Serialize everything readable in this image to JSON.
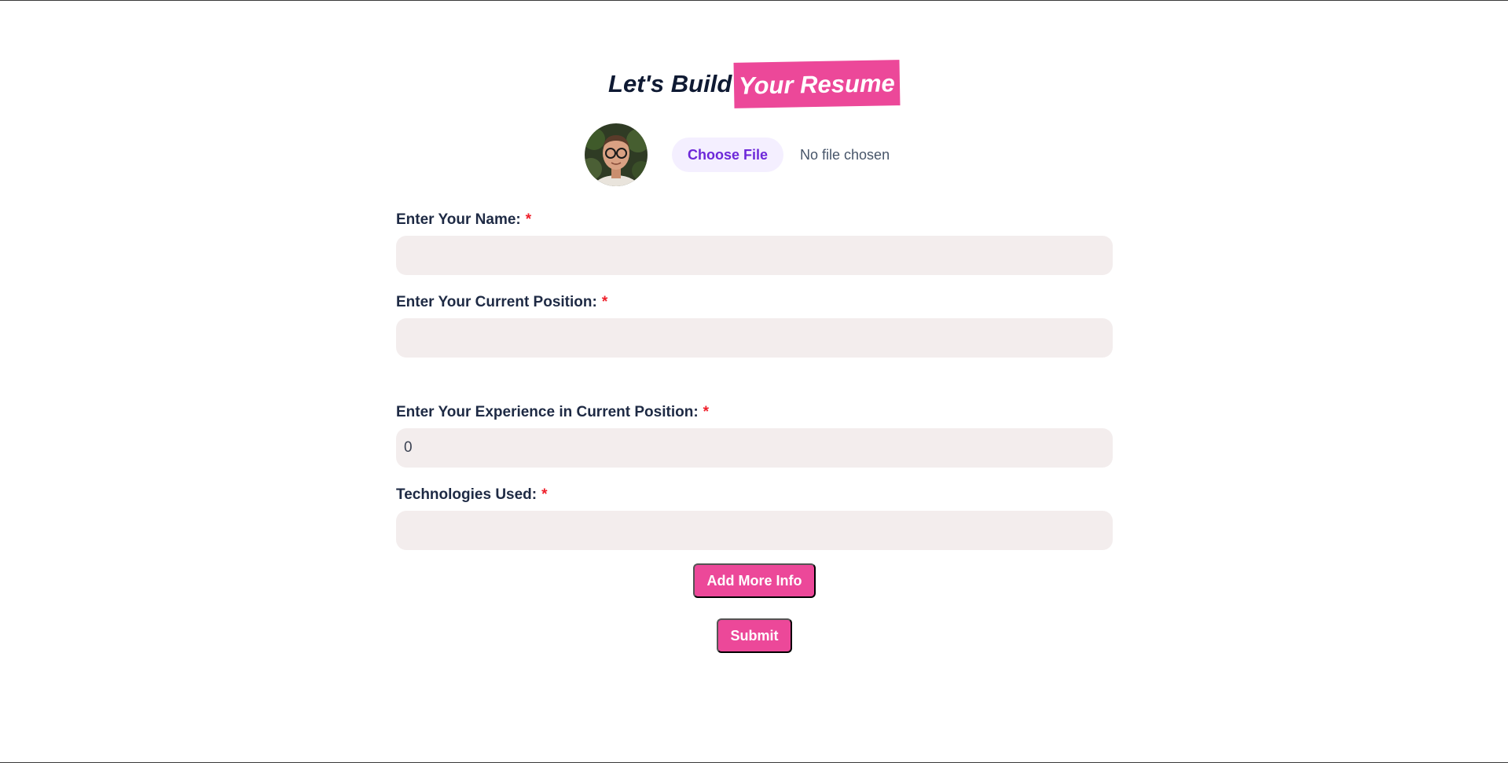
{
  "header": {
    "title_plain": "Let's Build",
    "title_highlight": "Your Resume",
    "accent_color": "#ec4899"
  },
  "upload": {
    "avatar_icon": "profile-photo",
    "choose_file_label": "Choose File",
    "file_status": "No file chosen"
  },
  "form": {
    "fields": [
      {
        "label": "Enter Your Name:",
        "required": "*",
        "value": ""
      },
      {
        "label": "Enter Your Current Position:",
        "required": "*",
        "value": ""
      },
      {
        "label": "Enter Your Experience in Current Position:",
        "required": "*",
        "value": "0"
      },
      {
        "label": "Technologies Used:",
        "required": "*",
        "value": ""
      }
    ],
    "add_more_label": "Add More Info",
    "submit_label": "Submit"
  }
}
